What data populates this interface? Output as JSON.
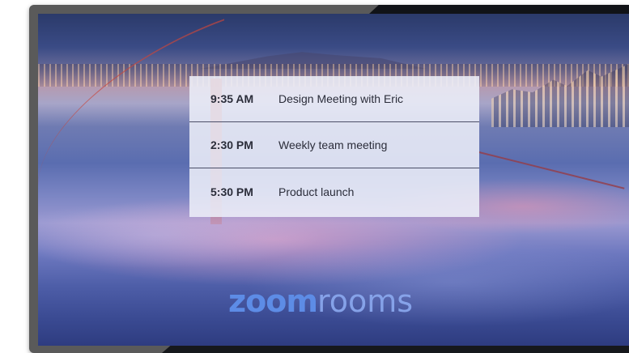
{
  "schedule": {
    "meetings": [
      {
        "time": "9:35 AM",
        "title": "Design Meeting with Eric"
      },
      {
        "time": "2:30 PM",
        "title": "Weekly team meeting"
      },
      {
        "time": "5:30 PM",
        "title": "Product launch"
      }
    ]
  },
  "logo": {
    "bold_text": "zoom",
    "light_text": "rooms"
  },
  "colors": {
    "logo_blue": "#5d8ce6",
    "card_background": "#eceef8",
    "text_dark": "#2b2d3a"
  }
}
